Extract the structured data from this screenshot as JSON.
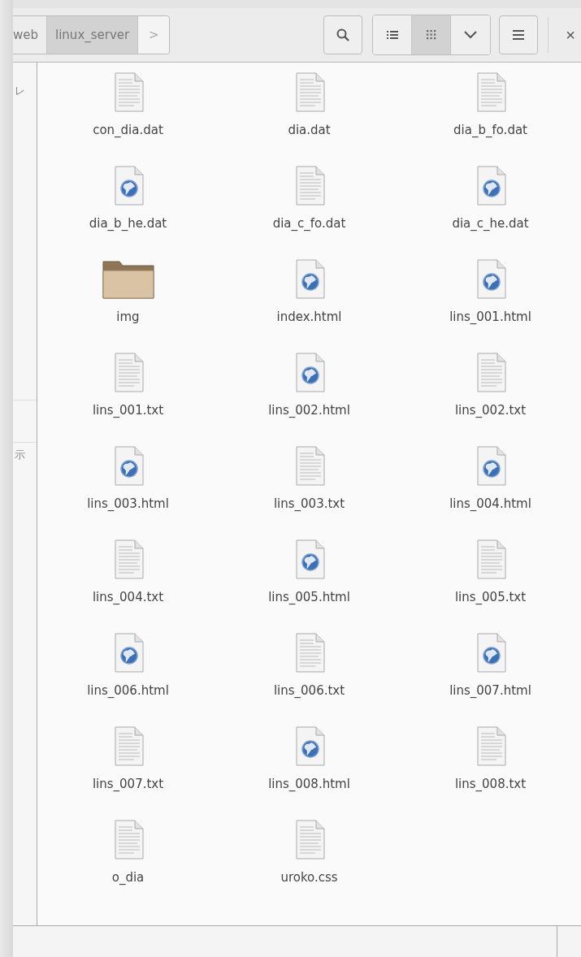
{
  "toolbar": {
    "path": [
      {
        "label": "web",
        "selected": false
      },
      {
        "label": "linux_server",
        "selected": true
      }
    ],
    "forward_label": ">",
    "views": [
      {
        "kind": "list",
        "selected": false
      },
      {
        "kind": "grid",
        "selected": true
      }
    ],
    "close_label": "×"
  },
  "sidebar": {
    "items": [
      {
        "label": "レ"
      },
      {
        "label": "示"
      }
    ]
  },
  "files": [
    {
      "name": "con_dia.dat",
      "kind": "text"
    },
    {
      "name": "dia.dat",
      "kind": "text"
    },
    {
      "name": "dia_b_fo.dat",
      "kind": "text"
    },
    {
      "name": "dia_b_he.dat",
      "kind": "web"
    },
    {
      "name": "dia_c_fo.dat",
      "kind": "text"
    },
    {
      "name": "dia_c_he.dat",
      "kind": "web"
    },
    {
      "name": "img",
      "kind": "folder"
    },
    {
      "name": "index.html",
      "kind": "web"
    },
    {
      "name": "lins_001.html",
      "kind": "web"
    },
    {
      "name": "lins_001.txt",
      "kind": "text"
    },
    {
      "name": "lins_002.html",
      "kind": "web"
    },
    {
      "name": "lins_002.txt",
      "kind": "text"
    },
    {
      "name": "lins_003.html",
      "kind": "web"
    },
    {
      "name": "lins_003.txt",
      "kind": "text"
    },
    {
      "name": "lins_004.html",
      "kind": "web"
    },
    {
      "name": "lins_004.txt",
      "kind": "text"
    },
    {
      "name": "lins_005.html",
      "kind": "web"
    },
    {
      "name": "lins_005.txt",
      "kind": "text"
    },
    {
      "name": "lins_006.html",
      "kind": "web"
    },
    {
      "name": "lins_006.txt",
      "kind": "text"
    },
    {
      "name": "lins_007.html",
      "kind": "web"
    },
    {
      "name": "lins_007.txt",
      "kind": "text"
    },
    {
      "name": "lins_008.html",
      "kind": "web"
    },
    {
      "name": "lins_008.txt",
      "kind": "text"
    },
    {
      "name": "o_dia",
      "kind": "text"
    },
    {
      "name": "uroko.css",
      "kind": "text"
    }
  ]
}
